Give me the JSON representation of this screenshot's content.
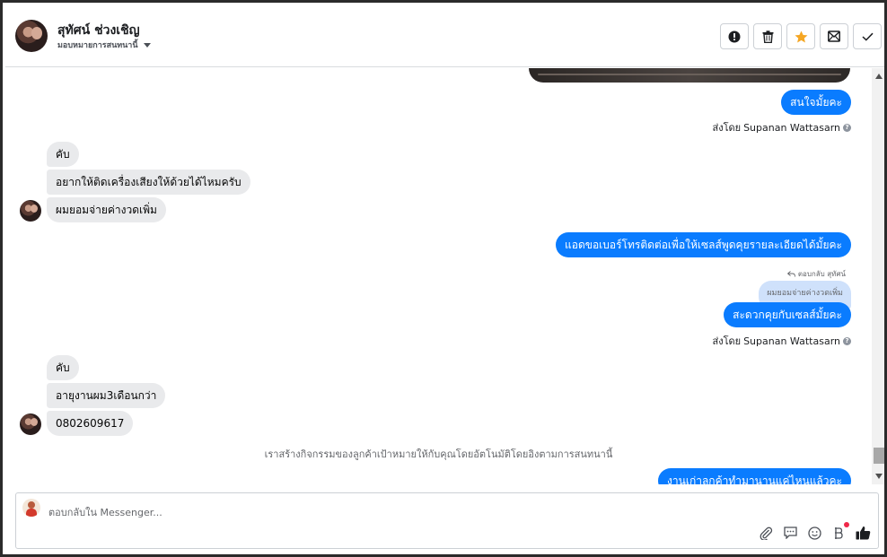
{
  "header": {
    "contact_name": "สุทัศน์ ช่วงเชิญ",
    "assign_label": "มอบหมายการสนทนานี้",
    "actions": [
      {
        "name": "mark-spam-button",
        "icon": "alert-circle-icon"
      },
      {
        "name": "delete-button",
        "icon": "trash-icon"
      },
      {
        "name": "star-button",
        "icon": "star-icon",
        "color": "#f5a623"
      },
      {
        "name": "mark-unread-button",
        "icon": "mail-icon"
      },
      {
        "name": "mark-done-button",
        "icon": "check-icon"
      }
    ]
  },
  "messages": {
    "m1": "สนใจมั้ยคะ",
    "sent_by_prefix": "ส่งโดย",
    "sent_by_name": "Supanan Wattasarn",
    "in1": "คับ",
    "in2": "อยากให้ติดเครื่องเสียงให้ด้วยได้ไหมครับ",
    "in3": "ผมยอมจ่ายค่างวดเพิ่ม",
    "m2": "แอดขอเบอร์โทรติดต่อเพื่อให้เซลส์พูดคุยรายละเอียดได้มั้ยคะ",
    "reply_note": "ตอบกลับ สุทัศน์",
    "reply_quote": "ผมยอมจ่ายค่างวดเพิ่ม",
    "m3": "สะดวกคุยกับเซลส์มั้ยคะ",
    "in4": "คับ",
    "in5": "อายุงานผม3เดือนกว่า",
    "in6": "0802609617",
    "system": "เราสร้างกิจกรรมของลูกค้าเป้าหมายให้กับคุณโดยอัตโนมัติโดยอิงตามการสนทนานี้",
    "m4": "งานเก่าลูกค้าทำมานานแค่ไหนแล้วคะ"
  },
  "composer": {
    "placeholder": "ตอบกลับใน Messenger...",
    "tools": [
      "attachment-icon",
      "saved-reply-icon",
      "emoji-icon",
      "payment-icon",
      "like-icon"
    ]
  },
  "colors": {
    "outgoing": "#0a7cff",
    "incoming": "#e9eaec",
    "star": "#f5a623"
  }
}
